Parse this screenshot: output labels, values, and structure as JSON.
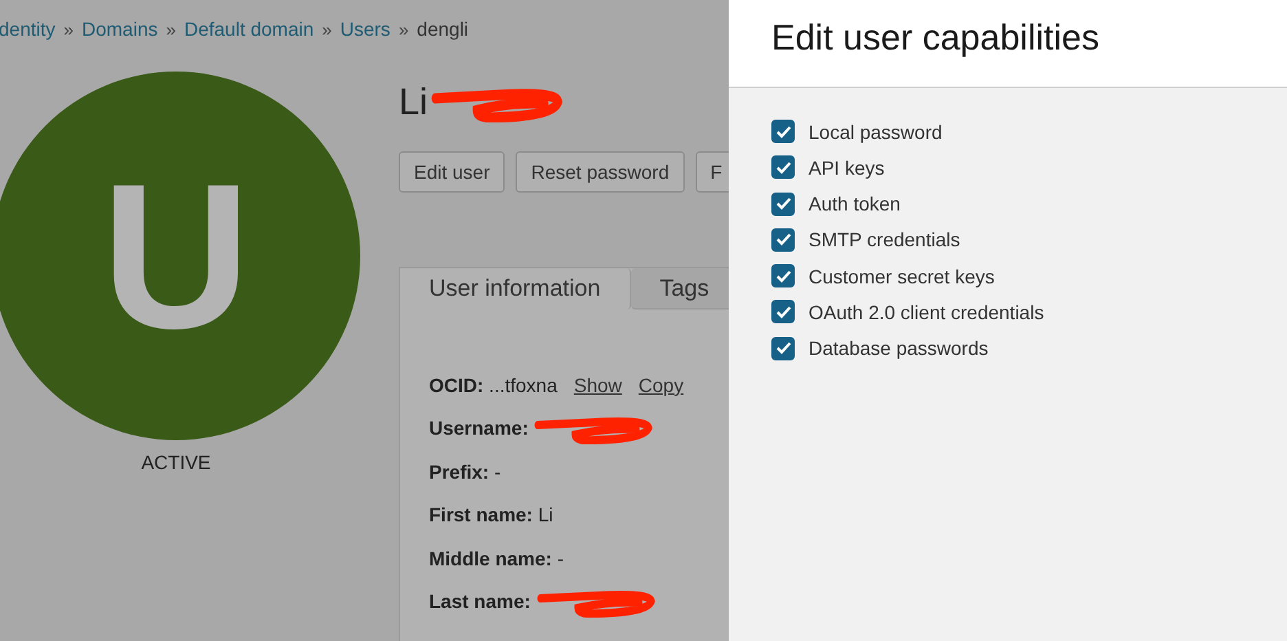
{
  "breadcrumb": [
    {
      "kind": "link",
      "label": "dentity"
    },
    {
      "kind": "separator",
      "label": "»"
    },
    {
      "kind": "link",
      "label": "Domains"
    },
    {
      "kind": "separator",
      "label": "»"
    },
    {
      "kind": "link",
      "label": "Default domain"
    },
    {
      "kind": "separator",
      "label": "»"
    },
    {
      "kind": "link",
      "label": "Users"
    },
    {
      "kind": "separator",
      "label": "»"
    },
    {
      "kind": "current",
      "label": "dengli"
    }
  ],
  "avatar": {
    "initial": "U",
    "status": "ACTIVE"
  },
  "title": {
    "text": "Li",
    "redacted": true
  },
  "buttons": [
    "Edit user",
    "Reset password",
    "F"
  ],
  "tabs": [
    {
      "label": "User information",
      "selected": true
    },
    {
      "label": "Tags",
      "selected": false
    }
  ],
  "fields": [
    {
      "kind": "entry",
      "text": "**OCID:** ...tfoxna",
      "links": [
        "Show",
        "Copy"
      ]
    },
    {
      "kind": "redacted",
      "text": "Username:"
    },
    {
      "kind": "entry",
      "text": "**Prefix:** -"
    },
    {
      "kind": "entry",
      "text": "**First name:** Li"
    },
    {
      "kind": "entry",
      "text": "**Middle name:** -"
    },
    {
      "kind": "redacted",
      "text": "Last name:"
    }
  ],
  "panel": {
    "title": "Edit user capabilities",
    "capabilities": [
      {
        "label": "Local password",
        "checked": true
      },
      {
        "label": "API keys",
        "checked": true
      },
      {
        "label": "Auth token",
        "checked": true
      },
      {
        "label": "SMTP credentials",
        "checked": true
      },
      {
        "label": "Customer secret keys",
        "checked": true
      },
      {
        "label": "OAuth 2.0 client credentials",
        "checked": true
      },
      {
        "label": "Database passwords",
        "checked": true
      }
    ]
  }
}
